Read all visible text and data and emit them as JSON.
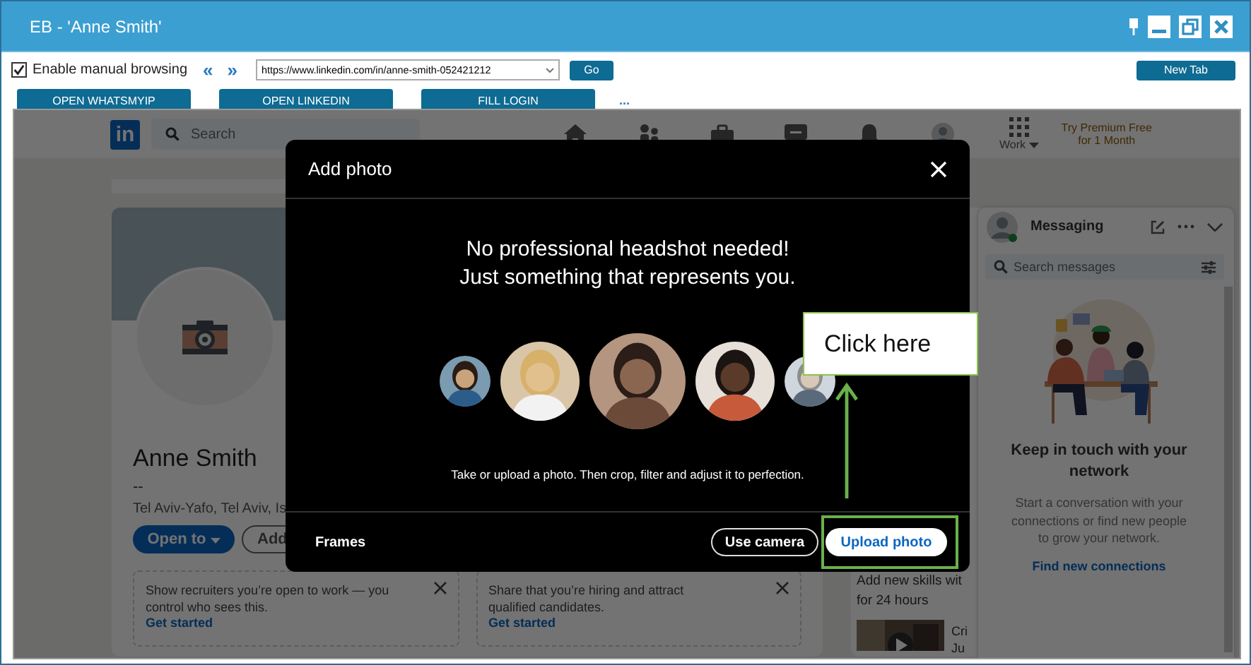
{
  "window": {
    "title": "EB - 'Anne Smith'"
  },
  "toolbar": {
    "manual_browsing": {
      "label": "Enable manual browsing",
      "checked": true
    },
    "back": "«",
    "forward": "»",
    "url": "https://www.linkedin.com/in/anne-smith-052421212",
    "go": "Go",
    "new_tab": "New Tab",
    "more": "...",
    "actions": [
      "OPEN WHATSMYIP",
      "OPEN LINKEDIN",
      "FILL LOGIN"
    ]
  },
  "page": {
    "nav": {
      "logo": "in",
      "search": {
        "placeholder": "Search"
      },
      "work": "Work",
      "premium": [
        "Try Premium Free",
        "for 1 Month"
      ]
    },
    "profile": {
      "name": "Anne Smith",
      "headline": "--",
      "location": "Tel Aviv-Yafo, Tel Aviv, Is",
      "open_to": "Open to",
      "add": "Add",
      "cards": [
        {
          "text": "Show recruiters you’re open to work — you control who sees this.",
          "link": "Get started"
        },
        {
          "text": "Share that you’re hiring and attract qualified candidates.",
          "link": "Get started"
        }
      ]
    },
    "learning": {
      "title": [
        "Add new skills wit",
        "for 24 hours"
      ],
      "course": [
        "Cri",
        "Ju"
      ]
    },
    "messaging": {
      "title": "Messaging",
      "search": {
        "placeholder": "Search messages"
      },
      "heading": "Keep in touch with your network",
      "body": "Start a conversation with your connections or find new people to grow your network.",
      "link": "Find new connections"
    }
  },
  "dialog": {
    "title": "Add photo",
    "headline": [
      "No professional headshot needed!",
      "Just something that represents you."
    ],
    "photos": [
      {
        "kind": "picture"
      },
      {
        "kind": "picture"
      },
      {
        "kind": "picture"
      },
      {
        "kind": "picture"
      },
      {
        "kind": "picture"
      }
    ],
    "caption": "Take or upload a photo. Then crop, filter and adjust it to perfection.",
    "frames": "Frames",
    "use_camera": "Use camera",
    "upload": "Upload photo"
  },
  "annotation": {
    "text": "Click here"
  }
}
